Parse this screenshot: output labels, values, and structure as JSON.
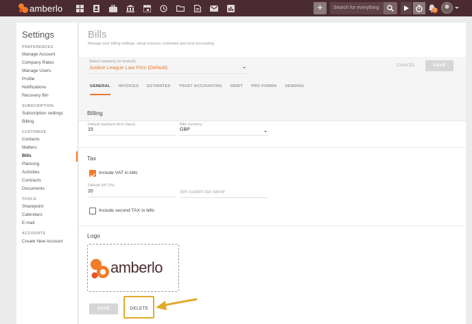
{
  "app": {
    "brand": "amberlo",
    "search_placeholder": "Search for everything",
    "notification_count": "2",
    "nav_icons": [
      "dashboard-icon",
      "contacts-icon",
      "matters-icon",
      "bank-icon",
      "calendar-icon",
      "activities-icon",
      "folder-icon",
      "documents-icon",
      "mail-icon",
      "reports-icon"
    ]
  },
  "sidebar": {
    "title": "Settings",
    "sections": [
      {
        "label": "PREFERENCES",
        "items": [
          "Manage Account",
          "Company Rates",
          "Manage Users",
          "Profile",
          "Notifications",
          "Recovery Bin"
        ]
      },
      {
        "label": "SUBSCRIPTION",
        "items": [
          "Subscription settings",
          "Billing"
        ]
      },
      {
        "label": "CUSTOMIZE",
        "items": [
          "Contacts",
          "Matters",
          "Bills",
          "Planning",
          "Activities",
          "Contracts",
          "Documents"
        ]
      },
      {
        "label": "TOOLS",
        "items": [
          "Sharepoint",
          "Calendars",
          "E-mail"
        ]
      },
      {
        "label": "ACCOUNTS",
        "items": [
          "Create New Account"
        ]
      }
    ],
    "active_item": "Bills"
  },
  "page": {
    "title": "Bills",
    "subtitle": "Manage your billing settings, setup invoices, estimates and trust accounting"
  },
  "company": {
    "label": "Select company (or branch)",
    "value": "Justice League Law Firm (Default)"
  },
  "actions": {
    "cancel": "CANCEL",
    "save": "SAVE"
  },
  "tabs": [
    "GENERAL",
    "INVOICES",
    "ESTIMATES",
    "TRUST ACCOUNTING",
    "DEBIT",
    "PRO FORMA",
    "SENDING"
  ],
  "billing": {
    "heading": "Billing",
    "term_label": "Default payment term (days)",
    "term_value": "15",
    "currency_label": "Bills currency",
    "currency_value": "GBP"
  },
  "tax": {
    "heading": "Tax",
    "include_vat_label": "Include VAT in bills",
    "include_vat_checked": true,
    "vat_label": "Default VAT (%)",
    "vat_value": "20",
    "custom_tax_placeholder": "Set custom tax name",
    "second_tax_label": "Include second TAX in bills",
    "second_tax_checked": false
  },
  "logo": {
    "heading": "Logo",
    "wordmark": "amberlo",
    "save": "SAVE",
    "delete": "DELETE"
  },
  "colors": {
    "topbar": "#4a2b31",
    "accent": "#f07c2a",
    "highlight": "#e2a92a"
  }
}
